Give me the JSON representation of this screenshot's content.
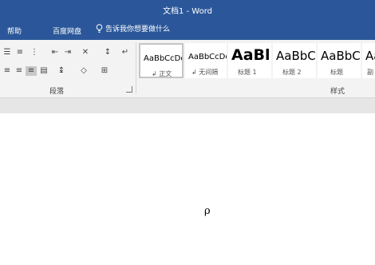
{
  "titlebar": {
    "title": "文档1 - Word"
  },
  "tabs": {
    "help": "帮助",
    "baidu_disk": "百度网盘",
    "tell_me": "告诉我你想要做什么"
  },
  "ribbon": {
    "paragraph_group_label": "段落",
    "styles_group_label": "样式",
    "styles": [
      {
        "preview": "AaBbCcDd",
        "name": "正文",
        "active": true
      },
      {
        "preview": "AaBbCcDd",
        "name": "无间隔",
        "active": false
      },
      {
        "preview": "AaBl",
        "name": "标题 1",
        "active": false
      },
      {
        "preview": "AaBbC",
        "name": "标题 2",
        "active": false
      },
      {
        "preview": "AaBbC",
        "name": "标题",
        "active": false
      },
      {
        "preview": "Aa",
        "name": "副",
        "active": false
      }
    ]
  },
  "document": {
    "text": "ρ"
  },
  "colors": {
    "brand": "#2b579a",
    "ribbon_bg": "#f3f3f3",
    "canvas_bg": "#e6e6e6"
  }
}
